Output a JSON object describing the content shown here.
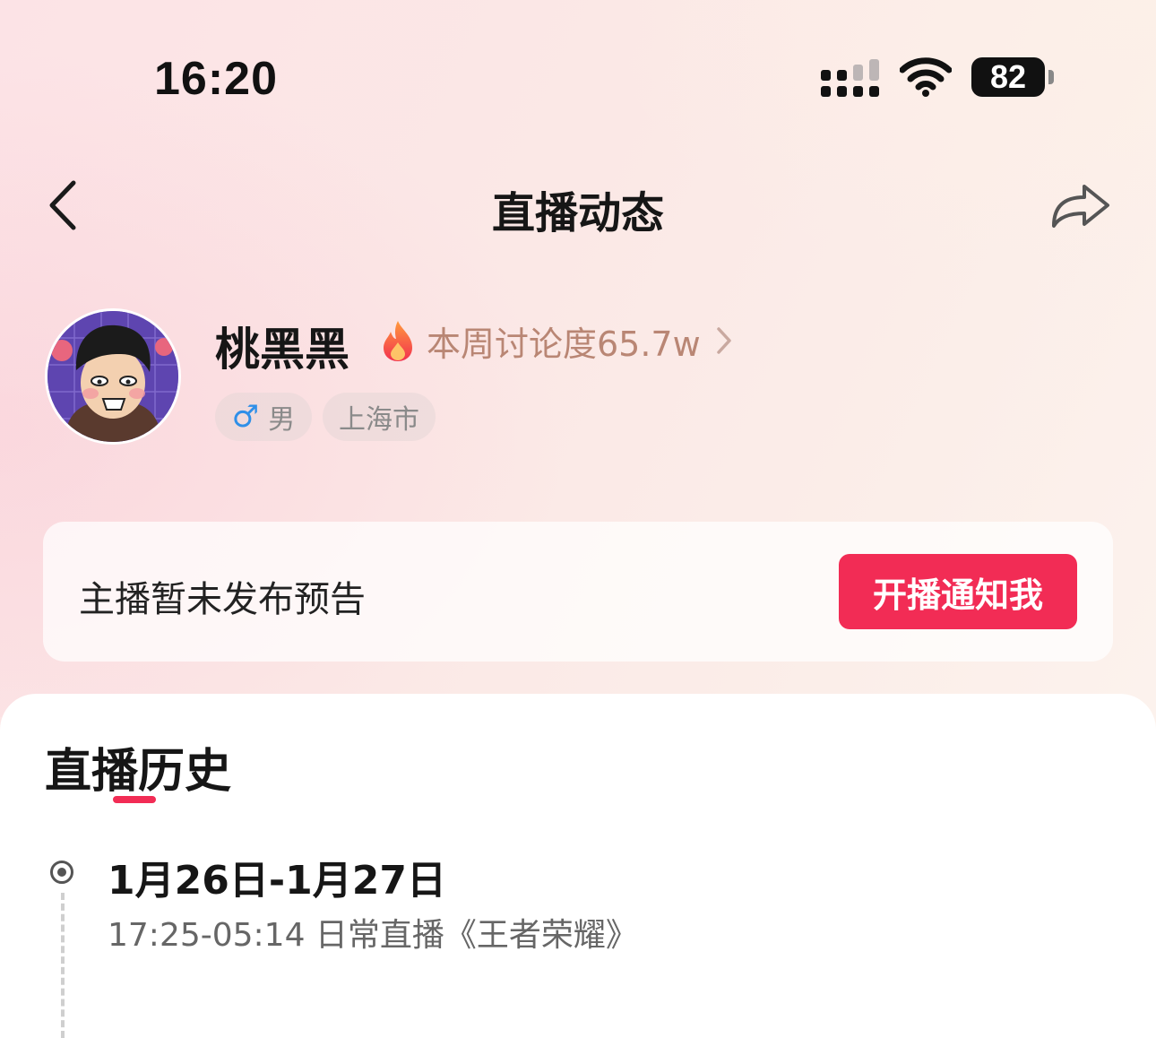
{
  "status_bar": {
    "time": "16:20",
    "battery": "82"
  },
  "nav": {
    "title": "直播动态"
  },
  "profile": {
    "username": "桃黑黑",
    "heat_text": "本周讨论度65.7w",
    "gender_symbol": "♂",
    "gender": "男",
    "city": "上海市"
  },
  "preview": {
    "message": "主播暂未发布预告",
    "notify_button": "开播通知我"
  },
  "history": {
    "title": "直播历史",
    "entries": [
      {
        "date": "1月26日-1月27日",
        "desc": "17:25-05:14 日常直播《王者荣耀》"
      }
    ]
  },
  "colors": {
    "accent": "#f22c55",
    "heat_text": "#b98674",
    "male": "#2f8fe8"
  }
}
